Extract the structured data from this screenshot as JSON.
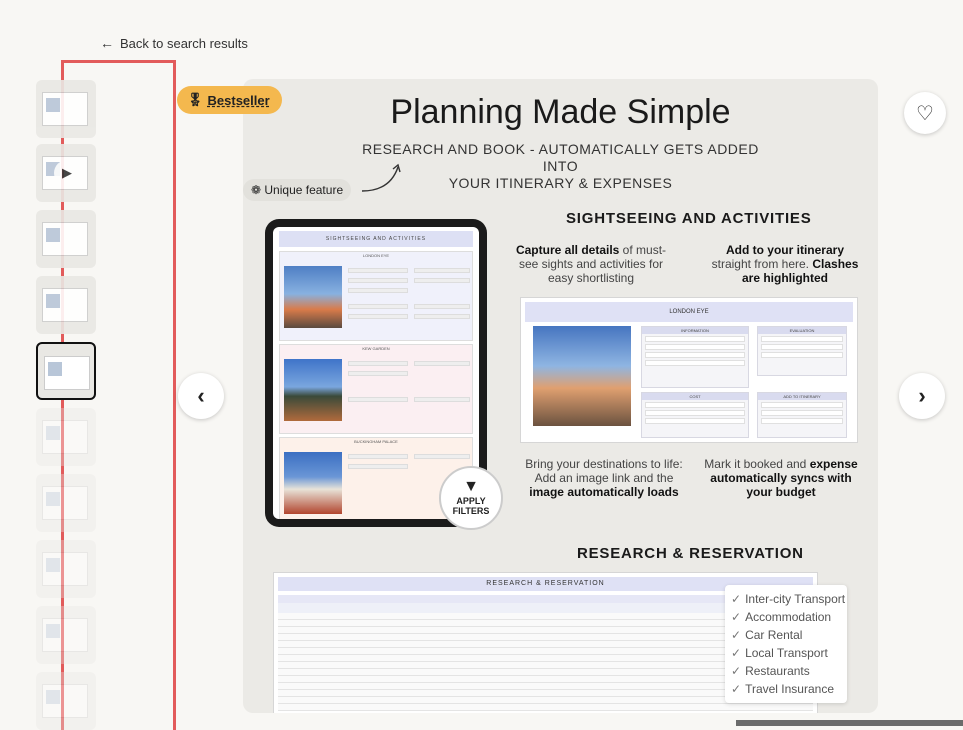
{
  "back_link": {
    "arrow": "←",
    "label": "Back to search results"
  },
  "badge": {
    "icon": "medal-icon",
    "label": "Bestseller"
  },
  "favorite": {
    "icon": "heart-icon",
    "glyph": "♡"
  },
  "nav": {
    "prev_glyph": "‹",
    "next_glyph": "›"
  },
  "thumbnails": {
    "count": 10,
    "selected_index": 4,
    "video_index": 1
  },
  "listing_image": {
    "title": "Planning Made Simple",
    "subtitle_line1": "RESEARCH AND BOOK - AUTOMATICALLY GETS ADDED INTO",
    "subtitle_line2": "YOUR ITINERARY & EXPENSES",
    "unique_feature": "Unique feature",
    "tablet": {
      "header": "SIGHTSEEING AND ACTIVITIES",
      "cards": [
        "LONDON EYE",
        "KEW GARDEN",
        "BUCKINGHAM PALACE"
      ]
    },
    "apply_filters": {
      "line1": "APPLY",
      "line2": "FILTERS"
    },
    "sightseeing_heading": "SIGHTSEEING AND ACTIVITIES",
    "note_capture": {
      "bold": "Capture all details",
      "rest": " of must-see sights and activities for easy shortlisting"
    },
    "note_itinerary": {
      "bold1": "Add to your itinerary",
      "mid": " straight from here. ",
      "bold2": "Clashes are highlighted"
    },
    "detail_card": {
      "title": "LONDON EYE",
      "blocks": [
        "INFORMATION",
        "EVALUATION",
        "COST",
        "ADD TO ITINERARY"
      ]
    },
    "note_image": {
      "rest": "Bring your destinations to life: Add an image link and the ",
      "bold": "image automatically loads"
    },
    "note_booked": {
      "rest": "Mark it booked and ",
      "bold": "expense automatically syncs with your budget"
    },
    "reservation_heading": "RESEARCH & RESERVATION",
    "res_table": {
      "header": "RESEARCH & RESERVATION"
    },
    "checklist": [
      "Inter-city Transport",
      "Accommodation",
      "Car Rental",
      "Local Transport",
      "Restaurants",
      "Travel Insurance"
    ]
  },
  "colors": {
    "badge": "#f4b84e",
    "selection_outline": "#e25b5b",
    "table_header": "#dfe1f5"
  }
}
